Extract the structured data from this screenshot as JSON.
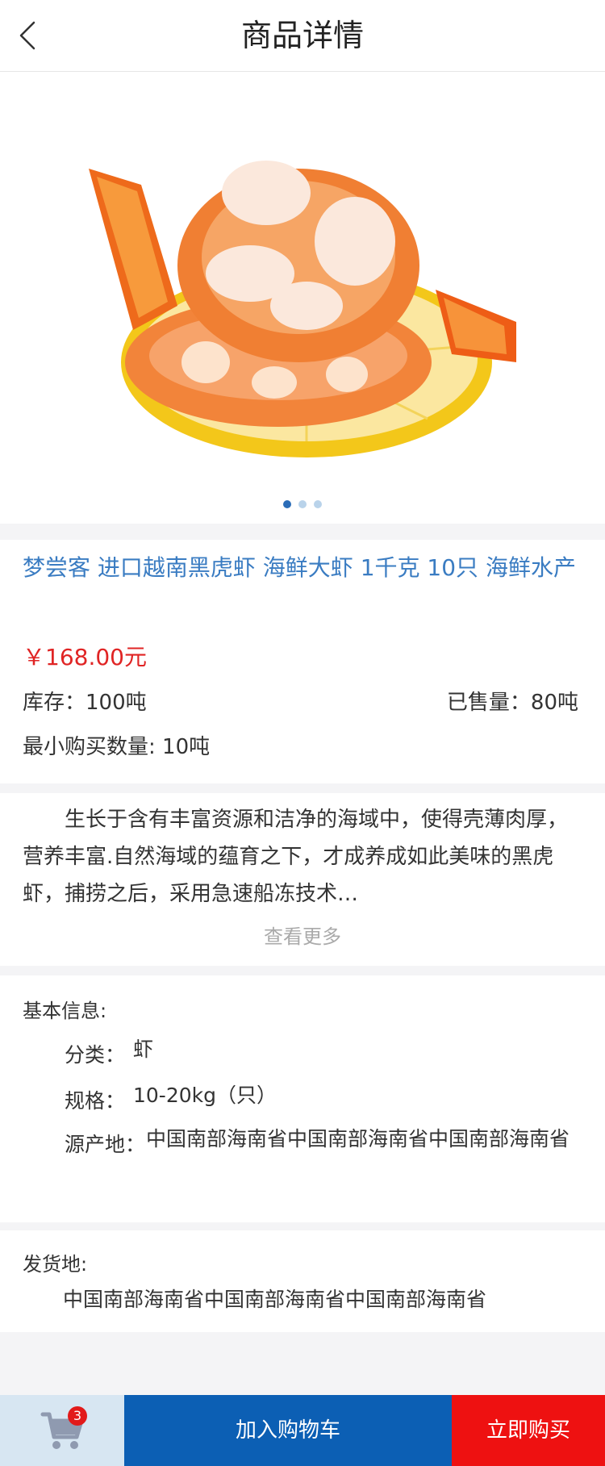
{
  "header": {
    "title": "商品详情",
    "back_icon": "chevron-left-icon"
  },
  "gallery": {
    "image": "shrimp-on-lemon-image",
    "dot_count": 3,
    "active_index": 0
  },
  "product": {
    "title": "梦尝客 进口越南黑虎虾 海鲜大虾 1千克 10只 海鲜水产",
    "price": "￥168.00元",
    "stock": "库存：100吨",
    "sold": "已售量：80吨",
    "min_qty": "最小购买数量: 10吨"
  },
  "description": {
    "text": "生长于含有丰富资源和洁净的海域中，使得壳薄肉厚，营养丰富.自然海域的蕴育之下，才成养成如此美味的黑虎虾，捕捞之后，采用急速船冻技术…",
    "more_label": "查看更多"
  },
  "basic_info": {
    "heading": "基本信息:",
    "category_label": "分类：",
    "category_value": "虾",
    "spec_label": "规格：",
    "spec_value": "10-20kg（只）",
    "origin_label": "源产地：",
    "origin_value": "中国南部海南省中国南部海南省中国南部海南省"
  },
  "shipping": {
    "heading": "发货地:",
    "value": "中国南部海南省中国南部海南省中国南部海南省"
  },
  "bottom_bar": {
    "cart_badge": "3",
    "add_to_cart": "加入购物车",
    "buy_now": "立即购买"
  },
  "colors": {
    "accent_blue": "#0c5fb4",
    "title_blue": "#3a7cc2",
    "price_red": "#e02424",
    "buy_red": "#ee1111",
    "cart_bg": "#d7e6f2"
  }
}
